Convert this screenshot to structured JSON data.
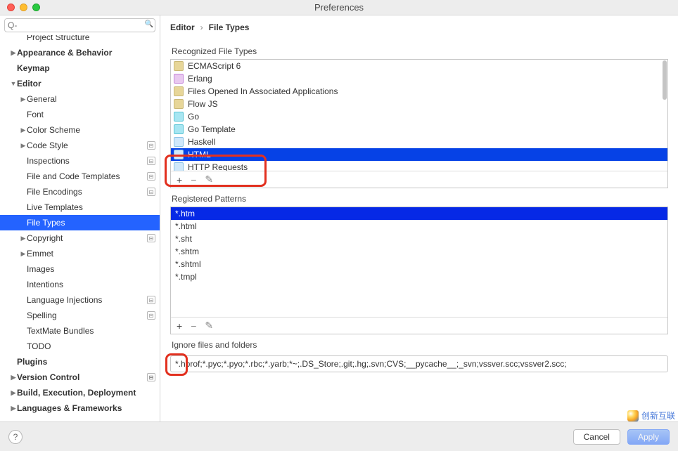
{
  "window": {
    "title": "Preferences"
  },
  "search": {
    "placeholder": "Q-"
  },
  "sidebar": {
    "items": [
      {
        "label": "Project Structure",
        "caret": "",
        "indent": 2,
        "bold": false,
        "cut": true
      },
      {
        "label": "Appearance & Behavior",
        "caret": "▶",
        "indent": 1,
        "bold": true
      },
      {
        "label": "Keymap",
        "caret": "",
        "indent": 1,
        "bold": true
      },
      {
        "label": "Editor",
        "caret": "▼",
        "indent": 1,
        "bold": true
      },
      {
        "label": "General",
        "caret": "▶",
        "indent": 2,
        "bold": false
      },
      {
        "label": "Font",
        "caret": "",
        "indent": 2,
        "bold": false
      },
      {
        "label": "Color Scheme",
        "caret": "▶",
        "indent": 2,
        "bold": false
      },
      {
        "label": "Code Style",
        "caret": "▶",
        "indent": 2,
        "bold": false,
        "badge": true
      },
      {
        "label": "Inspections",
        "caret": "",
        "indent": 2,
        "bold": false,
        "badge": true
      },
      {
        "label": "File and Code Templates",
        "caret": "",
        "indent": 2,
        "bold": false,
        "badge": true
      },
      {
        "label": "File Encodings",
        "caret": "",
        "indent": 2,
        "bold": false,
        "badge": true
      },
      {
        "label": "Live Templates",
        "caret": "",
        "indent": 2,
        "bold": false
      },
      {
        "label": "File Types",
        "caret": "",
        "indent": 2,
        "bold": false,
        "selected": true
      },
      {
        "label": "Copyright",
        "caret": "▶",
        "indent": 2,
        "bold": false,
        "badge": true
      },
      {
        "label": "Emmet",
        "caret": "▶",
        "indent": 2,
        "bold": false
      },
      {
        "label": "Images",
        "caret": "",
        "indent": 2,
        "bold": false
      },
      {
        "label": "Intentions",
        "caret": "",
        "indent": 2,
        "bold": false
      },
      {
        "label": "Language Injections",
        "caret": "",
        "indent": 2,
        "bold": false,
        "badge": true
      },
      {
        "label": "Spelling",
        "caret": "",
        "indent": 2,
        "bold": false,
        "badge": true
      },
      {
        "label": "TextMate Bundles",
        "caret": "",
        "indent": 2,
        "bold": false
      },
      {
        "label": "TODO",
        "caret": "",
        "indent": 2,
        "bold": false
      },
      {
        "label": "Plugins",
        "caret": "",
        "indent": 1,
        "bold": true
      },
      {
        "label": "Version Control",
        "caret": "▶",
        "indent": 1,
        "bold": true,
        "badge": true
      },
      {
        "label": "Build, Execution, Deployment",
        "caret": "▶",
        "indent": 1,
        "bold": true
      },
      {
        "label": "Languages & Frameworks",
        "caret": "▶",
        "indent": 1,
        "bold": true
      }
    ]
  },
  "breadcrumb": {
    "a": "Editor",
    "sep": "›",
    "b": "File Types"
  },
  "sections": {
    "recognized": "Recognized File Types",
    "patterns": "Registered Patterns",
    "ignore": "Ignore files and folders"
  },
  "filetypes": [
    {
      "label": "ECMAScript 6",
      "icon": ""
    },
    {
      "label": "Erlang",
      "icon": "erl"
    },
    {
      "label": "Files Opened In Associated Applications",
      "icon": ""
    },
    {
      "label": "Flow JS",
      "icon": ""
    },
    {
      "label": "Go",
      "icon": "go"
    },
    {
      "label": "Go Template",
      "icon": "go"
    },
    {
      "label": "Haskell",
      "icon": "blue"
    },
    {
      "label": "HTML",
      "icon": "blue",
      "selected": true
    },
    {
      "label": "HTTP Requests",
      "icon": "blue"
    }
  ],
  "ft_toolbar": {
    "add": "+",
    "remove": "−",
    "edit": "✎"
  },
  "patterns": [
    {
      "label": "*.htm",
      "selected": true
    },
    {
      "label": "*.html"
    },
    {
      "label": "*.sht"
    },
    {
      "label": "*.shtm"
    },
    {
      "label": "*.shtml"
    },
    {
      "label": "*.tmpl"
    }
  ],
  "ignore_value": "*.hprof;*.pyc;*.pyo;*.rbc;*.yarb;*~;.DS_Store;.git;.hg;.svn;CVS;__pycache__;_svn;vssver.scc;vssver2.scc;",
  "footer": {
    "help": "?",
    "cancel": "Cancel",
    "apply": "Apply"
  },
  "watermark": "创新互联"
}
